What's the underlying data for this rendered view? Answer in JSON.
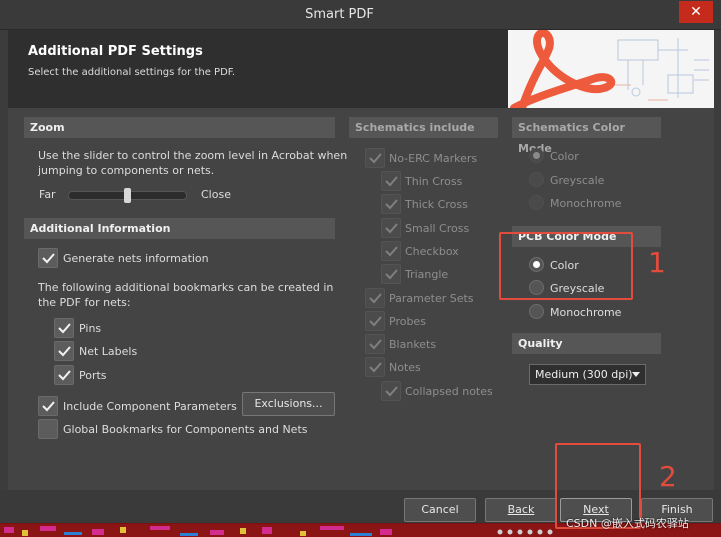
{
  "window": {
    "title": "Smart PDF",
    "close_glyph": "✕"
  },
  "header": {
    "title": "Additional PDF Settings",
    "subtitle": "Select the additional settings for the PDF."
  },
  "zoom": {
    "heading": "Zoom",
    "description_line1": "Use the slider to control the zoom level in Acrobat when",
    "description_line2": "jumping to components or nets.",
    "far_label": "Far",
    "close_label": "Close",
    "slider_level": 0.5
  },
  "additional_info": {
    "heading": "Additional Information",
    "generate_nets": {
      "label": "Generate nets information",
      "checked": true
    },
    "bookmarks_text_line1": "The following additional bookmarks can be created in",
    "bookmarks_text_line2": "the PDF for nets:",
    "bookmarks": [
      {
        "label": "Pins",
        "checked": true
      },
      {
        "label": "Net Labels",
        "checked": true
      },
      {
        "label": "Ports",
        "checked": true
      }
    ],
    "include_params": {
      "label": "Include Component Parameters",
      "checked": true
    },
    "exclusions_button": "Exclusions...",
    "global_bookmarks": {
      "label": "Global Bookmarks for Components and Nets",
      "checked": false
    }
  },
  "schematics_include": {
    "heading": "Schematics include",
    "items": [
      {
        "label": "No-ERC Markers",
        "checked": true,
        "level": 0
      },
      {
        "label": "Thin Cross",
        "checked": true,
        "level": 1
      },
      {
        "label": "Thick Cross",
        "checked": true,
        "level": 1
      },
      {
        "label": "Small Cross",
        "checked": true,
        "level": 1
      },
      {
        "label": "Checkbox",
        "checked": true,
        "level": 1
      },
      {
        "label": "Triangle",
        "checked": true,
        "level": 1
      },
      {
        "label": "Parameter Sets",
        "checked": true,
        "level": 0
      },
      {
        "label": "Probes",
        "checked": true,
        "level": 0
      },
      {
        "label": "Blankets",
        "checked": true,
        "level": 0
      },
      {
        "label": "Notes",
        "checked": true,
        "level": 0
      },
      {
        "label": "Collapsed notes",
        "checked": true,
        "level": 1
      }
    ]
  },
  "schematics_color_mode": {
    "heading": "Schematics Color Mode",
    "options": [
      {
        "label": "Color",
        "selected": true
      },
      {
        "label": "Greyscale",
        "selected": false
      },
      {
        "label": "Monochrome",
        "selected": false
      }
    ]
  },
  "pcb_color_mode": {
    "heading": "PCB Color Mode",
    "options": [
      {
        "label": "Color",
        "selected": true
      },
      {
        "label": "Greyscale",
        "selected": false
      },
      {
        "label": "Monochrome",
        "selected": false
      }
    ]
  },
  "quality": {
    "heading": "Quality",
    "selected": "Medium (300 dpi)"
  },
  "footer": {
    "cancel": "Cancel",
    "back": "Back",
    "next": "Next",
    "finish": "Finish"
  },
  "annotations": {
    "marker1": "1",
    "marker2": "2",
    "color": "#e34b3c"
  },
  "watermark": "CSDN @嵌入式码农驿站"
}
